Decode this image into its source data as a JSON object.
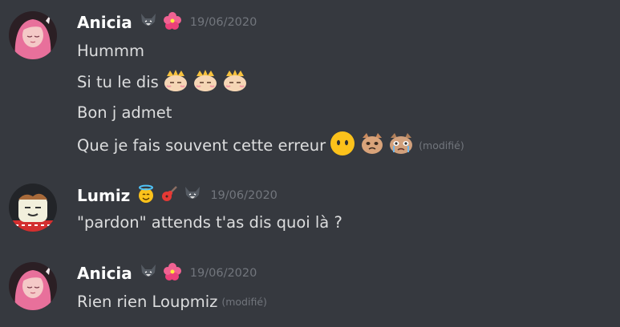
{
  "colors": {
    "background": "#36393f",
    "username": "#ffffff",
    "message_text": "#dcddde",
    "muted": "#72767d"
  },
  "messages": [
    {
      "author": "Anicia",
      "badge_icons": [
        "wolf-icon",
        "hibiscus-icon"
      ],
      "timestamp": "19/06/2020",
      "lines": [
        {
          "text": "Hummm",
          "edited": ""
        },
        {
          "text": "Si tu le dis",
          "edited": "",
          "emojis": [
            "cat-crown-emoji",
            "cat-crown-emoji",
            "cat-crown-emoji"
          ]
        },
        {
          "text": "Bon j admet",
          "edited": ""
        },
        {
          "text": "Que je fais souvent cette erreur",
          "edited": "(modifié)",
          "emojis": [
            "no-mouth-emoji",
            "cat-pout-emoji",
            "cat-crying-emoji"
          ]
        }
      ]
    },
    {
      "author": "Lumiz",
      "badge_icons": [
        "angel-smile-icon",
        "guitar-icon",
        "wolf-icon"
      ],
      "timestamp": "19/06/2020",
      "lines": [
        {
          "text": "\"pardon\" attends t'as dis quoi là ?",
          "edited": ""
        }
      ]
    },
    {
      "author": "Anicia",
      "badge_icons": [
        "wolf-icon",
        "hibiscus-icon"
      ],
      "timestamp": "19/06/2020",
      "lines": [
        {
          "text": "Rien rien Loupmiz",
          "edited": "(modifié)"
        }
      ]
    }
  ]
}
